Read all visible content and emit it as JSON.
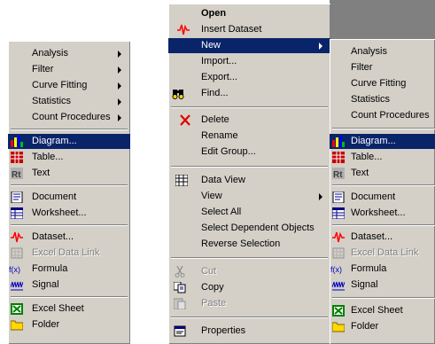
{
  "left_menu": {
    "items": [
      {
        "label": "Analysis",
        "submenu": true
      },
      {
        "label": "Filter",
        "submenu": true
      },
      {
        "label": "Curve Fitting",
        "submenu": true
      },
      {
        "label": "Statistics",
        "submenu": true
      },
      {
        "label": "Count Procedures",
        "submenu": true
      },
      {
        "label": "Diagram...",
        "icon": "bar-chart-icon",
        "highlighted": true
      },
      {
        "label": "Table...",
        "icon": "table-icon"
      },
      {
        "label": "Text",
        "icon": "text-icon"
      },
      {
        "label": "Document",
        "icon": "document-icon"
      },
      {
        "label": "Worksheet...",
        "icon": "worksheet-icon"
      },
      {
        "label": "Dataset...",
        "icon": "dataset-icon"
      },
      {
        "label": "Excel Data Link",
        "icon": "excel-link-icon",
        "disabled": true
      },
      {
        "label": "Formula",
        "icon": "formula-icon"
      },
      {
        "label": "Signal",
        "icon": "signal-icon"
      },
      {
        "label": "Excel Sheet",
        "icon": "excel-sheet-icon"
      },
      {
        "label": "Folder",
        "icon": "folder-icon"
      }
    ]
  },
  "context_menu": {
    "items": [
      {
        "label": "Open",
        "bold": true
      },
      {
        "label": "Insert Dataset",
        "icon": "insert-dataset-icon"
      },
      {
        "label": "New",
        "submenu": true,
        "highlighted": true
      },
      {
        "label": "Import..."
      },
      {
        "label": "Export..."
      },
      {
        "label": "Find...",
        "icon": "binoculars-icon"
      },
      {
        "label": "Delete",
        "icon": "delete-icon"
      },
      {
        "label": "Rename"
      },
      {
        "label": "Edit Group..."
      },
      {
        "label": "Data View",
        "icon": "data-view-icon"
      },
      {
        "label": "View",
        "submenu": true
      },
      {
        "label": "Select All"
      },
      {
        "label": "Select Dependent Objects"
      },
      {
        "label": "Reverse Selection"
      },
      {
        "label": "Cut",
        "icon": "scissors-icon",
        "disabled": true
      },
      {
        "label": "Copy",
        "icon": "copy-icon"
      },
      {
        "label": "Paste",
        "icon": "paste-icon",
        "disabled": true
      },
      {
        "label": "Properties",
        "icon": "properties-icon"
      }
    ]
  },
  "right_menu": {
    "items": [
      {
        "label": "Analysis"
      },
      {
        "label": "Filter"
      },
      {
        "label": "Curve Fitting"
      },
      {
        "label": "Statistics"
      },
      {
        "label": "Count Procedures"
      },
      {
        "label": "Diagram...",
        "icon": "bar-chart-icon",
        "highlighted": true
      },
      {
        "label": "Table...",
        "icon": "table-icon"
      },
      {
        "label": "Text",
        "icon": "text-icon"
      },
      {
        "label": "Document",
        "icon": "document-icon"
      },
      {
        "label": "Worksheet...",
        "icon": "worksheet-icon"
      },
      {
        "label": "Dataset...",
        "icon": "dataset-icon"
      },
      {
        "label": "Excel Data Link",
        "icon": "excel-link-icon",
        "disabled": true
      },
      {
        "label": "Formula",
        "icon": "formula-icon"
      },
      {
        "label": "Signal",
        "icon": "signal-icon"
      },
      {
        "label": "Excel Sheet",
        "icon": "excel-sheet-icon"
      },
      {
        "label": "Folder",
        "icon": "folder-icon"
      }
    ]
  },
  "colors": {
    "menu_bg": "#d4d0c8",
    "highlight": "#0a246a",
    "disabled_text": "#808080"
  }
}
